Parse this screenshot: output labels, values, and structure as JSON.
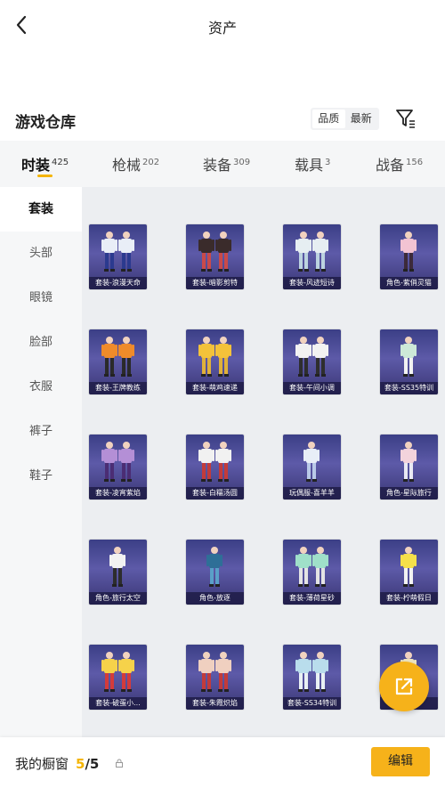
{
  "header": {
    "title": "资产",
    "back_icon": "chevron-left-icon"
  },
  "section": {
    "title": "游戏仓库",
    "sort_options": [
      "品质",
      "最新"
    ],
    "sort_active": "品质",
    "filter_icon": "filter-icon"
  },
  "tabs": [
    {
      "label": "时装",
      "count": "425",
      "active": true
    },
    {
      "label": "枪械",
      "count": "202"
    },
    {
      "label": "装备",
      "count": "309"
    },
    {
      "label": "载具",
      "count": "3"
    },
    {
      "label": "战备",
      "count": "156"
    }
  ],
  "sidebar": [
    {
      "label": "套装",
      "active": true
    },
    {
      "label": "头部"
    },
    {
      "label": "眼镜"
    },
    {
      "label": "脸部"
    },
    {
      "label": "衣服"
    },
    {
      "label": "裤子"
    },
    {
      "label": "鞋子"
    }
  ],
  "items": [
    {
      "label": "套装-浪漫天命"
    },
    {
      "label": "套装-暗影剪特"
    },
    {
      "label": "套装-风迹短诗"
    },
    {
      "label": "角色-紫俏灵猫"
    },
    {
      "label": "套装-王牌教练"
    },
    {
      "label": "套装-萌鸡速递"
    },
    {
      "label": "套装-午间小调"
    },
    {
      "label": "套装-SS35特训"
    },
    {
      "label": "套装-凌宵紫焰"
    },
    {
      "label": "套装-白糯汤圆"
    },
    {
      "label": "玩偶服-喜羊羊"
    },
    {
      "label": "角色-星际旅行"
    },
    {
      "label": "角色-旅行太空"
    },
    {
      "label": "角色-放逐"
    },
    {
      "label": "套装-薄荷星砂"
    },
    {
      "label": "套装-柠萌假日"
    },
    {
      "label": "套装-破蛋小..."
    },
    {
      "label": "套装-朱霞炽焰"
    },
    {
      "label": "套装-SS34特训"
    },
    {
      "label": "...焰"
    }
  ],
  "fab": {
    "icon": "share-external-icon"
  },
  "bottom": {
    "label": "我的橱窗",
    "current": "5",
    "total": "/5",
    "lock_icon": "lock-icon",
    "edit_label": "编辑"
  },
  "colors": {
    "accent": "#f6b21a",
    "card_bg": "#4b4a96"
  }
}
